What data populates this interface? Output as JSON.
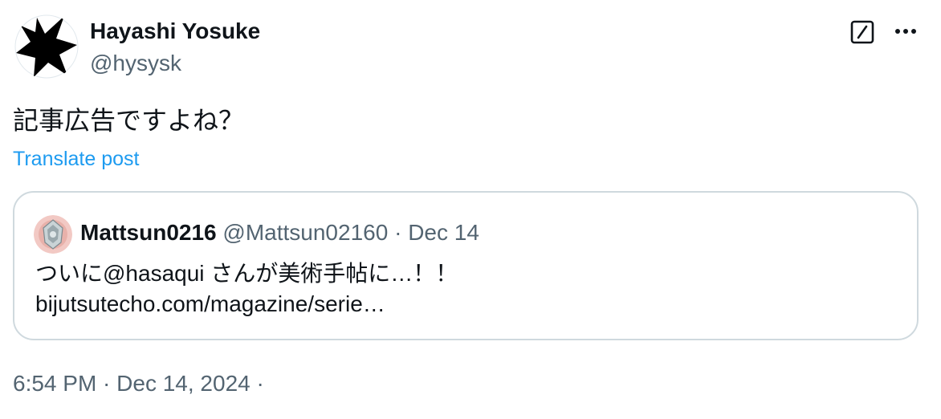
{
  "post": {
    "author_name": "Hayashi Yosuke",
    "author_handle": "@hysysk",
    "text": "記事広告ですよね？",
    "translate_label": "Translate post",
    "timestamp": "6:54 PM · Dec 14, 2024 ·",
    "icons": {
      "avatar": "black-star-avatar",
      "grok": "grok-slash-box-icon",
      "more": "more-horizontal-icon"
    }
  },
  "quote": {
    "author_name": "Mattsun0216",
    "author_handle": "@Mattsun02160",
    "separator": "·",
    "date": "Dec 14",
    "text_line1": "ついに@hasaqui さんが美術手帖に…！！",
    "text_line2": "bijutsutecho.com/magazine/serie…",
    "avatar_icon": "jeweled-circle-avatar"
  },
  "colors": {
    "text_primary": "#0f1419",
    "text_secondary": "#536471",
    "link": "#1d9bf0",
    "border": "#cfd9de"
  }
}
